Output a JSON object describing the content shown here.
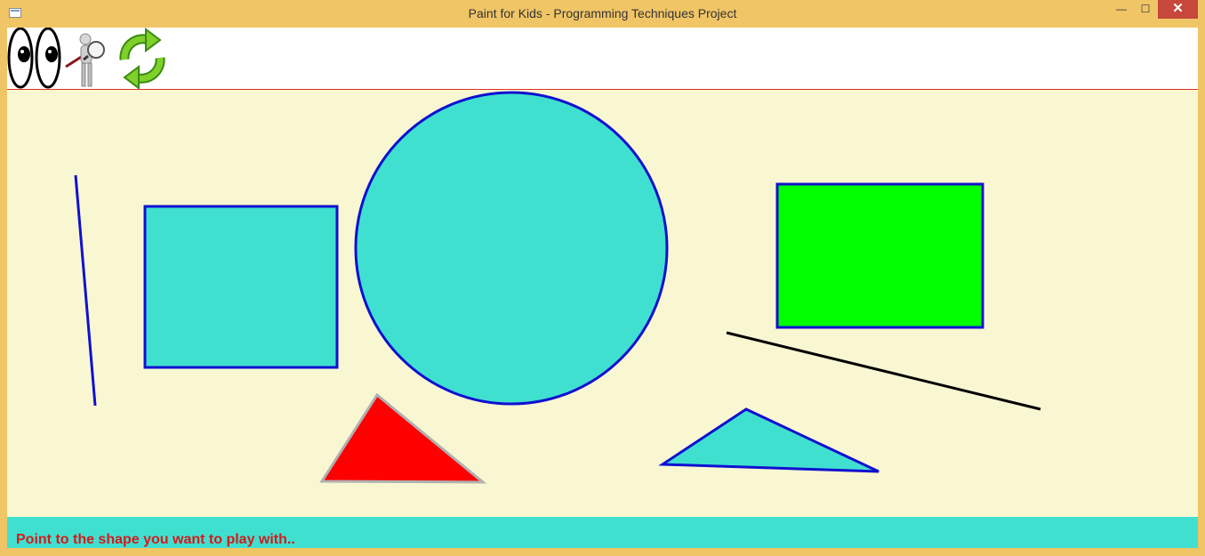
{
  "window": {
    "title": "Paint for Kids - Programming Techniques Project",
    "controls": {
      "minimize": "—",
      "maximize": "☐",
      "close": "✕"
    }
  },
  "toolbar": {
    "items": [
      {
        "name": "eyes-icon"
      },
      {
        "name": "magnifier-figure-icon"
      },
      {
        "name": "refresh-icon"
      }
    ]
  },
  "canvas": {
    "background": "#f8f7d2",
    "shapes": [
      {
        "type": "line",
        "stroke": "#1010d0"
      },
      {
        "type": "rectangle",
        "fill": "#40e0d0",
        "stroke": "#1010d0"
      },
      {
        "type": "circle",
        "fill": "#40e0d0",
        "stroke": "#1010d0"
      },
      {
        "type": "rectangle",
        "fill": "#00ff00",
        "stroke": "#1010d0"
      },
      {
        "type": "line",
        "stroke": "#000000"
      },
      {
        "type": "triangle",
        "fill": "#ff0000",
        "stroke": "#b0b0b0"
      },
      {
        "type": "triangle",
        "fill": "#40e0d0",
        "stroke": "#1010d0"
      }
    ]
  },
  "statusbar": {
    "message": "Point to the shape you want to play with..",
    "background": "#40e0d0",
    "text_color": "#d21b1b"
  }
}
